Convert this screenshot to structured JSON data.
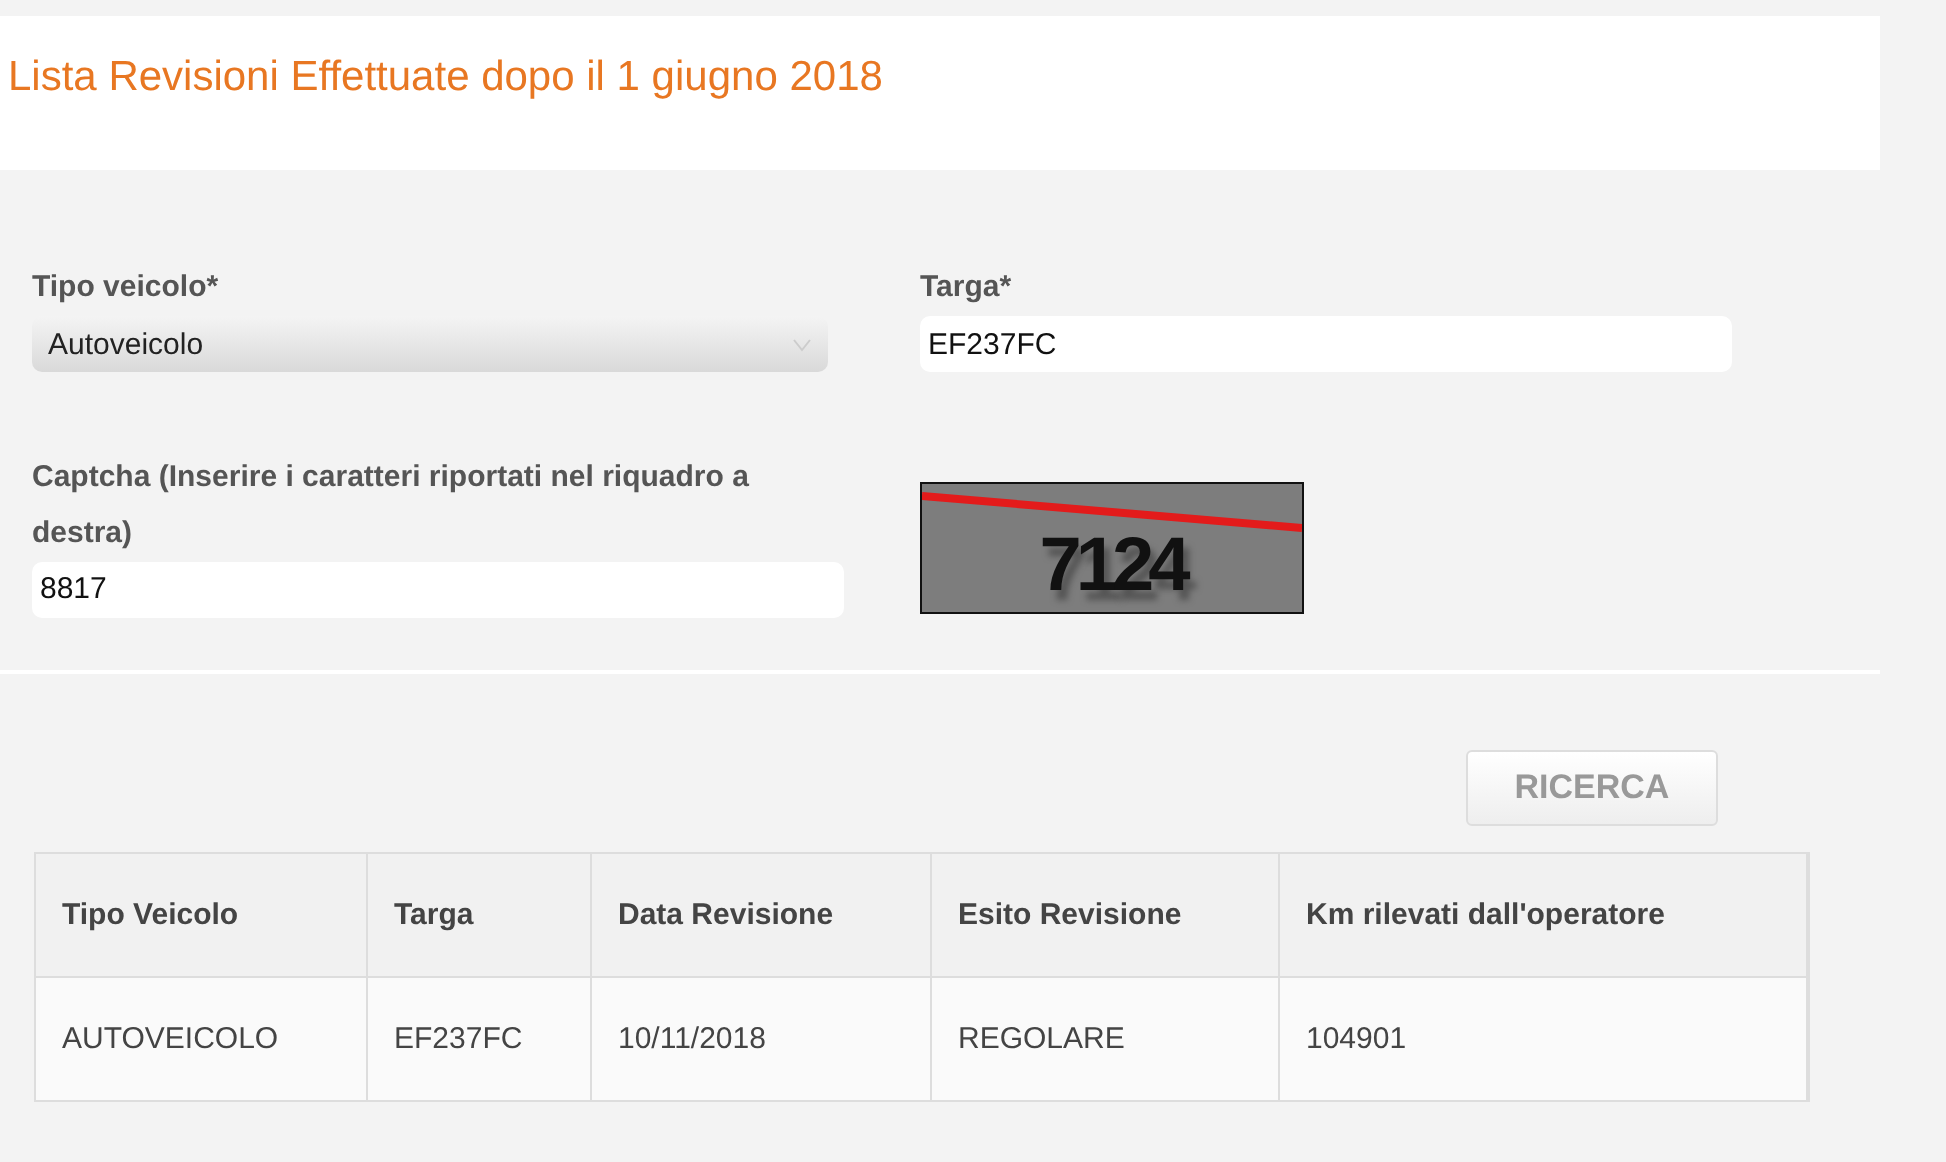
{
  "title": "Lista Revisioni Effettuate dopo il 1 giugno 2018",
  "form": {
    "vehicle_type": {
      "label": "Tipo veicolo*",
      "value": "Autoveicolo"
    },
    "plate": {
      "label": "Targa*",
      "value": "EF237FC"
    },
    "captcha": {
      "label": "Captcha (Inserire i caratteri riportati nel riquadro a destra)",
      "value": "8817",
      "image_text": "7124"
    }
  },
  "search_button": {
    "label": "RICERCA",
    "disabled": true
  },
  "table": {
    "columns": [
      "Tipo Veicolo",
      "Targa",
      "Data Revisione",
      "Esito Revisione",
      "Km rilevati dall'operatore"
    ],
    "rows": [
      [
        "AUTOVEICOLO",
        "EF237FC",
        "10/11/2018",
        "REGOLARE",
        "104901"
      ]
    ]
  }
}
